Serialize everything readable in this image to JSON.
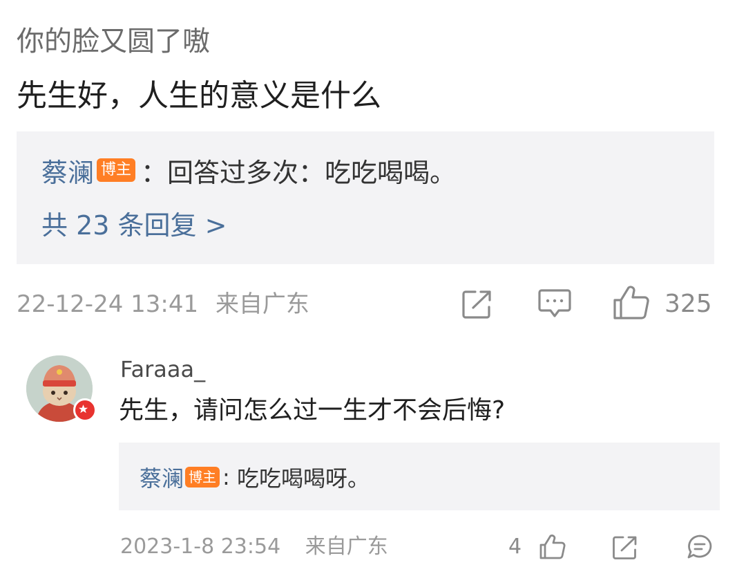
{
  "post": {
    "username": "你的脸又圆了嗷",
    "text": "先生好，人生的意义是什么",
    "reply_preview": {
      "author": "蔡澜",
      "badge": "博主",
      "separator": "：",
      "text": "回答过多次：吃吃喝喝。",
      "more_label": "共 23 条回复 >"
    },
    "timestamp": "22-12-24 13:41",
    "location": "来自广东",
    "like_count": "325",
    "icons": [
      "share-icon",
      "comment-icon",
      "like-icon"
    ]
  },
  "reply": {
    "username": "Faraaa_",
    "text": "先生，请问怎么过一生才不会后悔?",
    "sub_reply": {
      "author": "蔡澜",
      "badge": "博主",
      "separator": ":",
      "text": " 吃吃喝喝呀。"
    },
    "timestamp": "2023-1-8 23:54",
    "location": "来自广东",
    "like_count": "4",
    "icons": [
      "like-icon",
      "share-icon",
      "comment-icon"
    ],
    "avatar": "cat-avatar",
    "verified_badge": "star-badge-icon"
  },
  "colors": {
    "link_blue": "#4a6f9a",
    "badge_orange": "#ff7e24",
    "reply_bg": "#f3f3f5",
    "meta_gray": "#9a9a9a",
    "verified_red": "#e8332f"
  }
}
